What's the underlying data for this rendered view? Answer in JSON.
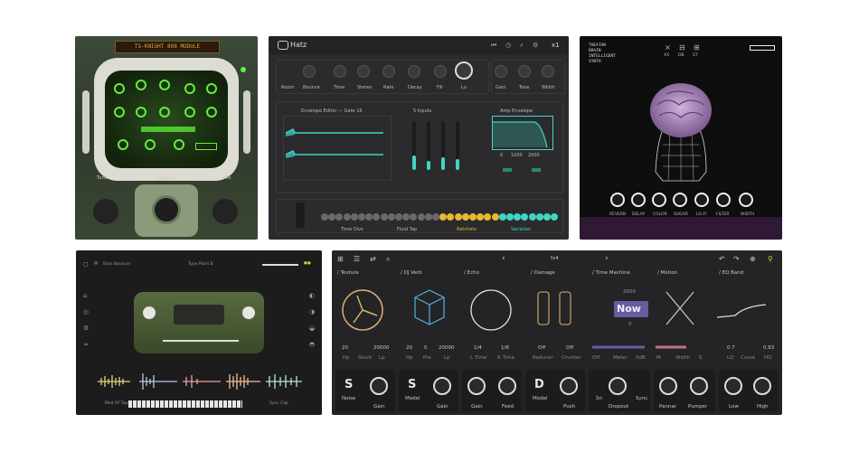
{
  "crt_panel": {
    "badge": "TS-KNIGHT 808 MODULE",
    "bottom_left": "Tune",
    "bottom_center": "Volume",
    "bottom_right": "Mix"
  },
  "hatz": {
    "logo": "Hatz",
    "preset": "x1",
    "top_knobs": [
      "Room",
      "Bounce",
      "Time",
      "Stereo",
      "Rate",
      "Decay",
      "Fill",
      "Lo",
      "Gain",
      "Tone",
      "Width"
    ],
    "envelope_title": "Envelope Editor — Gate 16",
    "faders_title": "5 Inputs",
    "filter_title": "Amp Envelope",
    "filter_values": [
      "0",
      "1000",
      "2000"
    ],
    "bottom_labels": [
      "Time Divs",
      "Fluid Tap",
      "Ratchets",
      "Variation"
    ]
  },
  "brain": {
    "title_lines": [
      "THEATAN",
      "BRAIN",
      "INTELLIGENT",
      "SYNTH"
    ],
    "icons": [
      "XX",
      "DB",
      "ST",
      "CL"
    ],
    "knobs": [
      "REVERB",
      "DELAY",
      "COLOR",
      "SUGAR",
      "LO-FI",
      "FILTER",
      "WIDTH"
    ]
  },
  "tape": {
    "preset": "Bass Bouncer",
    "title": "Type Plant B",
    "bottom_left": "Mod Of Tape",
    "bottom_right": "Sync Clip"
  },
  "fx": {
    "top_center": "fx4",
    "sections": [
      "/ Texture",
      "/ DJ Verb",
      "/ Echo",
      "/ Damage",
      "/ Time Machine",
      "/ Motion",
      "/ EQ Band"
    ],
    "time_machine_value": "Now",
    "time_machine_top": "2000",
    "time_machine_sub": "0",
    "values_row": [
      "20",
      "20000",
      "20",
      "0",
      "20000",
      "1/4",
      "1/8",
      "Off",
      "Off",
      "0.7",
      "0.83"
    ],
    "sublabels_row": [
      "Hp",
      "Stuck",
      "Lp",
      "Hp",
      "Pre",
      "Lp",
      "L Time",
      "R Time",
      "Reducer",
      "Crusher",
      "Off",
      "Meter",
      "0dB",
      "M",
      "Width",
      "S",
      "LQ",
      "Curve",
      "HQ"
    ],
    "bottom_letters": [
      "S",
      "S",
      "D"
    ],
    "bottom_labels": [
      "Noise",
      "Gain",
      "Model",
      "Gain",
      "Gain",
      "Feed",
      "Model",
      "Push",
      "Sn",
      "Dropout",
      "Sync",
      "Pannar",
      "Pumper",
      "Low",
      "High"
    ]
  }
}
